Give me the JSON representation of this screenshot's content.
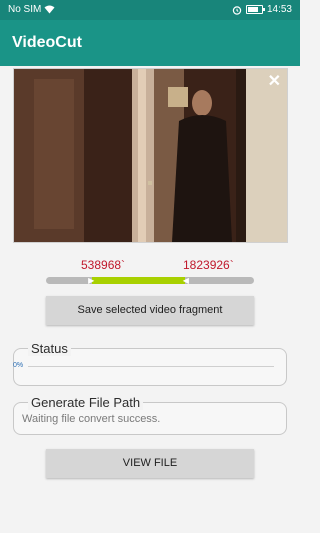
{
  "status_bar": {
    "carrier": "No SIM",
    "time": "14:53",
    "battery_level": 0.8,
    "icons": [
      "wifi-icon",
      "alarm-icon",
      "battery-icon"
    ]
  },
  "app_bar": {
    "title": "VideoCut"
  },
  "video": {
    "close_label": "✕"
  },
  "range": {
    "start_label": "538968`",
    "end_label": "1823926`",
    "selection_start_fraction": 0.22,
    "selection_end_fraction": 0.67,
    "colors": {
      "selected": "#a8d000",
      "track": "#b9b9b9",
      "label": "#c0182c"
    }
  },
  "buttons": {
    "save_label": "Save selected video fragment",
    "view_label": "VIEW FILE"
  },
  "status_panel": {
    "legend": "Status",
    "progress_label": "0%",
    "progress_value": 0
  },
  "path_panel": {
    "legend": "Generate File Path",
    "text": "Waiting file convert success."
  },
  "colors": {
    "primary": "#1a9487",
    "primary_dark": "#18857a"
  }
}
